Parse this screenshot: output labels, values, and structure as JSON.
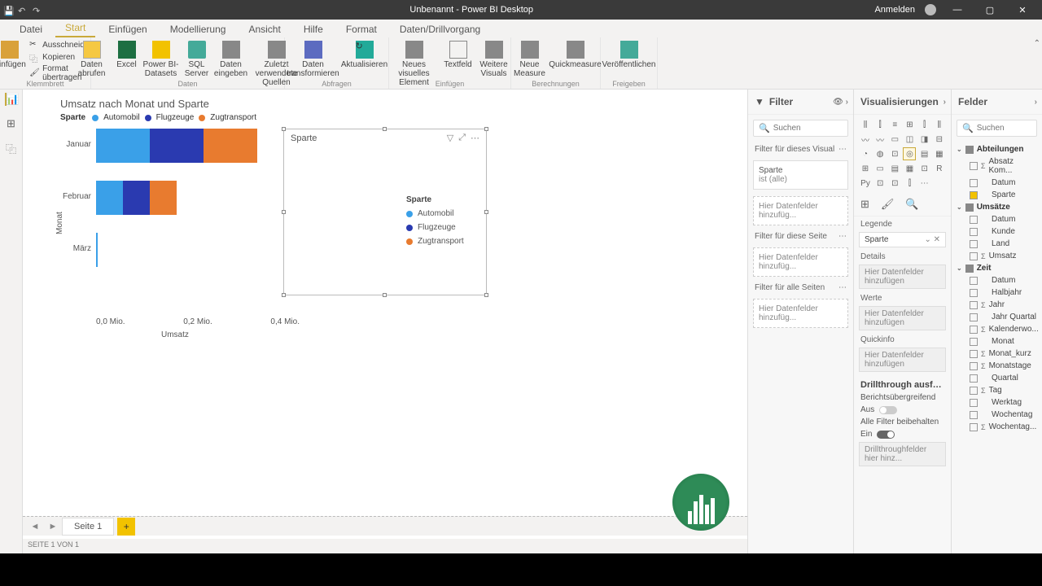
{
  "title": "Unbenannt - Power BI Desktop",
  "signin": "Anmelden",
  "tabs": [
    "Datei",
    "Start",
    "Einfügen",
    "Modellierung",
    "Ansicht",
    "Hilfe",
    "Format",
    "Daten/Drillvorgang"
  ],
  "active_tab": 1,
  "clipboard": {
    "cut": "Ausschneiden",
    "copy": "Kopieren",
    "paint": "Format übertragen",
    "group": "Klemmbrett",
    "paste": "Einfügen"
  },
  "data_group": {
    "get": "Daten abrufen",
    "excel": "Excel",
    "pbids": "Power BI-Datasets",
    "sql": "SQL Server",
    "enter": "Daten eingeben",
    "recent": "Zuletzt verwendete Quellen",
    "group": "Daten"
  },
  "query_group": {
    "transform": "Daten transformieren",
    "refresh": "Aktualisieren",
    "group": "Abfragen"
  },
  "insert_group": {
    "newvis": "Neues visuelles Element",
    "textbox": "Textfeld",
    "more": "Weitere Visuals",
    "group": "Einfügen"
  },
  "calc_group": {
    "measure": "Neue Measure",
    "quick": "Quickmeasure",
    "group": "Berechnungen"
  },
  "share_group": {
    "publish": "Veröffentlichen",
    "group": "Freigeben"
  },
  "chart": {
    "title": "Umsatz nach Monat und Sparte",
    "legend_label": "Sparte",
    "series": [
      "Automobil",
      "Flugzeuge",
      "Zugtransport"
    ],
    "colors": [
      "#3aa0e8",
      "#2a3ab0",
      "#e87b2f"
    ],
    "ylabel": "Monat",
    "xlabel": "Umsatz",
    "xticks": [
      "0,0 Mio.",
      "0,2 Mio.",
      "0,4 Mio."
    ]
  },
  "chart_data": {
    "type": "bar",
    "orientation": "horizontal",
    "stacked": true,
    "title": "Umsatz nach Monat und Sparte",
    "xlabel": "Umsatz",
    "ylabel": "Monat",
    "xlim": [
      0,
      0.4
    ],
    "x_unit": "Mio.",
    "categories": [
      "Januar",
      "Februar",
      "März"
    ],
    "series": [
      {
        "name": "Automobil",
        "color": "#3aa0e8",
        "values": [
          0.12,
          0.06,
          0.003
        ]
      },
      {
        "name": "Flugzeuge",
        "color": "#2a3ab0",
        "values": [
          0.12,
          0.06,
          0.0
        ]
      },
      {
        "name": "Zugtransport",
        "color": "#e87b2f",
        "values": [
          0.12,
          0.06,
          0.0
        ]
      }
    ]
  },
  "slicer": {
    "title": "Sparte",
    "category": "Sparte",
    "items": [
      "Automobil",
      "Flugzeuge",
      "Zugtransport"
    ]
  },
  "filter_pane": {
    "title": "Filter",
    "search": "Suchen",
    "visual": "Filter für dieses Visual",
    "page": "Filter für diese Seite",
    "all": "Filter für alle Seiten",
    "add": "Hier Datenfelder hinzufüg...",
    "card_field": "Sparte",
    "card_state": "ist (alle)"
  },
  "viz_pane": {
    "title": "Visualisierungen",
    "legend": "Legende",
    "legend_field": "Sparte",
    "details": "Details",
    "values": "Werte",
    "tooltip": "Quickinfo",
    "drill": "Drillthrough ausf…",
    "cross": "Berichtsübergreifend",
    "off": "Aus",
    "keep": "Alle Filter beibehalten",
    "on": "Ein",
    "drillfields": "Drillthroughfelder hier hinz...",
    "add": "Hier Datenfelder hinzufügen"
  },
  "fields_pane": {
    "title": "Felder",
    "search": "Suchen",
    "tables": [
      {
        "name": "Abteilungen",
        "expanded": true,
        "fields": [
          {
            "n": "Absatz Kom...",
            "sigma": true
          },
          {
            "n": "Datum"
          },
          {
            "n": "Sparte",
            "checked": true
          }
        ]
      },
      {
        "name": "Umsätze",
        "expanded": true,
        "fields": [
          {
            "n": "Datum"
          },
          {
            "n": "Kunde"
          },
          {
            "n": "Land"
          },
          {
            "n": "Umsatz",
            "sigma": true
          }
        ]
      },
      {
        "name": "Zeit",
        "expanded": true,
        "fields": [
          {
            "n": "Datum"
          },
          {
            "n": "Halbjahr"
          },
          {
            "n": "Jahr",
            "sigma": true
          },
          {
            "n": "Jahr Quartal"
          },
          {
            "n": "Kalenderwo...",
            "sigma": true
          },
          {
            "n": "Monat"
          },
          {
            "n": "Monat_kurz",
            "sigma": true
          },
          {
            "n": "Monatstage",
            "sigma": true
          },
          {
            "n": "Quartal"
          },
          {
            "n": "Tag",
            "sigma": true
          },
          {
            "n": "Werktag"
          },
          {
            "n": "Wochentag"
          },
          {
            "n": "Wochentag...",
            "sigma": true
          }
        ]
      }
    ]
  },
  "page_tab": "Seite 1",
  "status": "SEITE 1 VON 1"
}
